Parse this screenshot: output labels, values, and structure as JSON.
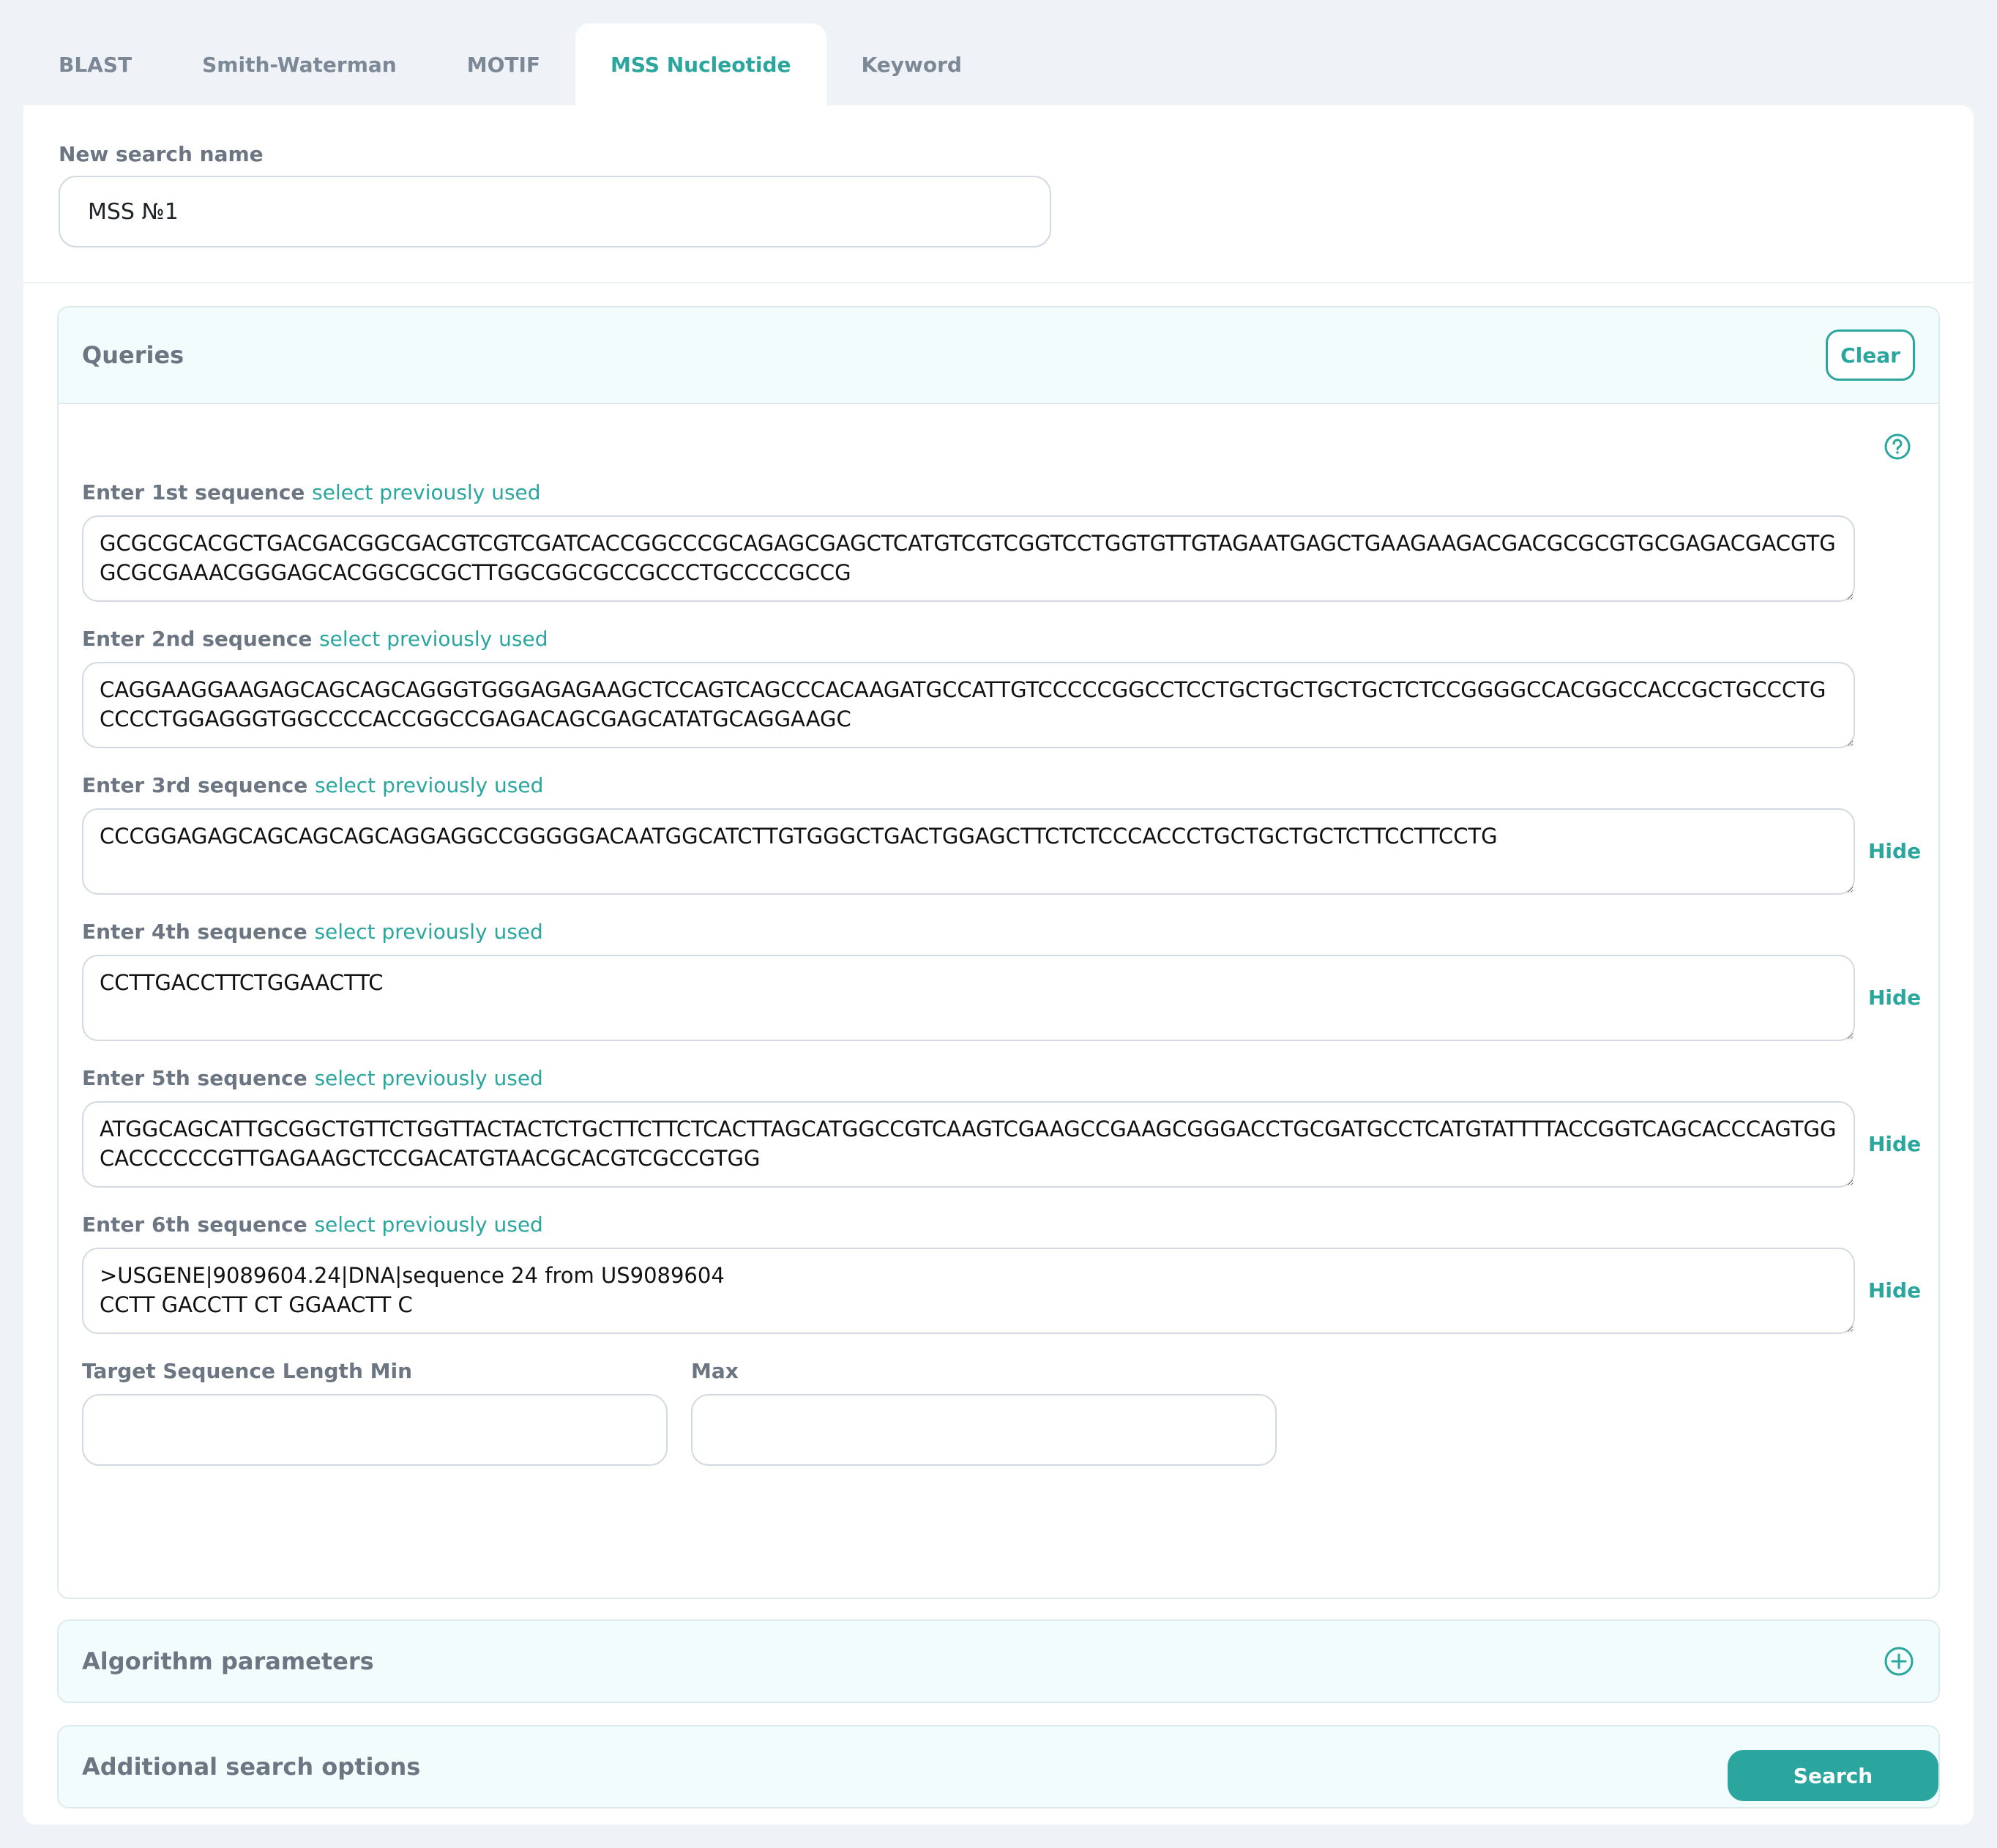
{
  "tabs": [
    {
      "label": "BLAST"
    },
    {
      "label": "Smith-Waterman"
    },
    {
      "label": "MOTIF"
    },
    {
      "label": "MSS Nucleotide"
    },
    {
      "label": "Keyword"
    }
  ],
  "name": {
    "label": "New search name",
    "value": "MSS №1"
  },
  "queries": {
    "title": "Queries",
    "clear_label": "Clear",
    "select_link": "select previously used",
    "hide_label": "Hide",
    "sequences": [
      {
        "label": "Enter 1st sequence",
        "value": "GCGCGCACGCTGACGACGGCGACGTCGTCGATCACCGGCCCGCAGAGCGAGCTCATGTCGTCGGTCCTGGTGTTGTAGAATGAGCTGAAGAAGACGACGCGCGTGCGAGACGACGTGGCGCGAAACGGGAGCACGGCGCGCTTGGCGGCGCCGCCCTGCCCCGCCG"
      },
      {
        "label": "Enter 2nd sequence",
        "value": "CAGGAAGGAAGAGCAGCAGCAGGGTGGGAGAGAAGCTCCAGTCAGCCCACAAGATGCCATTGTCCCCCGGCCTCCTGCTGCTGCTGCTCTCCGGGGCCACGGCCACCGCTGCCCTGCCCCTGGAGGGTGGCCCCACCGGCCGAGACAGCGAGCATATGCAGGAAGC"
      },
      {
        "label": "Enter 3rd sequence",
        "value": "CCCGGAGAGCAGCAGCAGCAGGAGGCCGGGGGACAATGGCATCTTGTGGGCTGACTGGAGCTTCTCTCCCACCCTGCTGCTGCTCTTCCTTCCTG"
      },
      {
        "label": "Enter 4th sequence",
        "value": "CCTTGACCTTCTGGAACTTC"
      },
      {
        "label": "Enter 5th sequence",
        "value": "ATGGCAGCATTGCGGCTGTTCTGGTTACTACTCTGCTTCTTCTCACTTAGCATGGCCGTCAAGTCGAAGCCGAAGCGGGACCTGCGATGCCTCATGTATTTTACCGGTCAGCACCCAGTGGCACCCCCCGTTGAGAAGCTCCGACATGTAACGCACGTCGCCGTGG"
      },
      {
        "label": "Enter 6th sequence",
        "value": ">USGENE|9089604.24|DNA|sequence 24 from US9089604\nCCTT GACCTT CT GGAACTT C"
      }
    ],
    "length_min_label": "Target Sequence Length Min",
    "length_max_label": "Max"
  },
  "algorithm": {
    "title": "Algorithm parameters"
  },
  "additional": {
    "title": "Additional search options"
  },
  "search_label": "Search",
  "colors": {
    "accent": "#2aa69e",
    "panel_bg": "#f2fcfd",
    "page_bg": "#eff3f8"
  },
  "icons": {
    "help": "help-circle-icon",
    "expand": "plus-circle-icon"
  }
}
